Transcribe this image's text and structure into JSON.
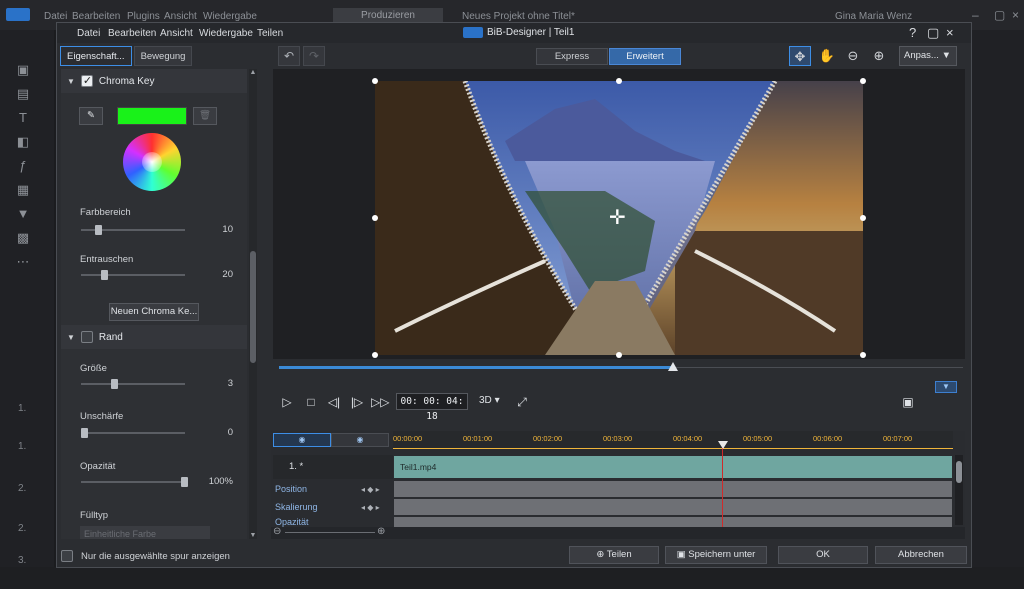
{
  "app": {
    "menu": [
      "Datei",
      "Bearbeiten",
      "Plugins",
      "Ansicht",
      "Wiedergabe"
    ],
    "produce_label": "Produzieren",
    "project_title": "Neues Projekt ohne Titel*",
    "user": "Gina Maria Wenz",
    "tracks": [
      "1.",
      "1.",
      "2.",
      "2.",
      "3."
    ]
  },
  "dialog": {
    "menu": [
      "Datei",
      "Bearbeiten",
      "Ansicht",
      "Wiedergabe",
      "Teilen"
    ],
    "title": "BiB-Designer  |  Teil1",
    "help": "?",
    "tabs": {
      "properties": "Eigenschaft...",
      "motion": "Bewegung"
    },
    "chroma": {
      "section_label": "Chroma Key",
      "enabled": true,
      "key_color": "#19f219",
      "color_range_label": "Farbbereich",
      "color_range_value": "10",
      "noise_label": "Entrauschen",
      "noise_value": "20",
      "new_button": "Neuen Chroma Ke..."
    },
    "border": {
      "section_label": "Rand",
      "enabled": false,
      "size_label": "Größe",
      "size_value": "3",
      "blur_label": "Unschärfe",
      "blur_value": "0",
      "opacity_label": "Opazität",
      "opacity_value": "100%",
      "fill_label": "Fülltyp",
      "fill_value": "Einheitliche Farbe"
    },
    "modes": {
      "express": "Express",
      "advanced": "Erweitert"
    },
    "zoom_select": "Anpas...",
    "playback": {
      "timecode": "00: 00: 04: 18",
      "three_d": "3D",
      "progress": 0.57
    },
    "timeline": {
      "ticks": [
        "00:00:00",
        "00:01:00",
        "00:02:00",
        "00:03:00",
        "00:04:00",
        "00:05:00",
        "00:06:00",
        "00:07:00"
      ],
      "track_label": "1.  *",
      "clip_name": "Teil1.mp4",
      "keyframe_rows": [
        "Position",
        "Skalierung",
        "Opazität"
      ]
    },
    "footer": {
      "only_selected_label": "Nur die ausgewählte spur anzeigen",
      "share": "Teilen",
      "save_as": "Speichern unter",
      "ok": "OK",
      "cancel": "Abbrechen"
    }
  }
}
